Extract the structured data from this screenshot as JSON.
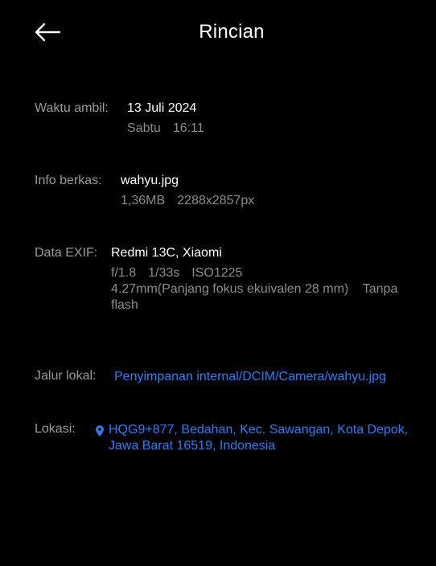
{
  "header": {
    "title": "Rincian",
    "back_icon": "arrow-left-icon"
  },
  "waktu_ambil": {
    "label": "Waktu ambil:",
    "date": "13 Juli 2024",
    "day": "Sabtu",
    "time": "16:11"
  },
  "info_berkas": {
    "label": "Info berkas:",
    "filename": "wahyu.jpg",
    "size": "1,36MB",
    "resolution": "2288x2857px"
  },
  "data_exif": {
    "label": "Data EXIF:",
    "device": "Redmi 13C, Xiaomi",
    "aperture": "f/1.8",
    "shutter": "1/33s",
    "iso": "ISO1225",
    "focal_line1": "4.27mm(Panjang fokus ekuivalen 28 mm)    Tanpa",
    "focal_line2": "flash"
  },
  "jalur_lokal": {
    "label": "Jalur lokal:",
    "path": "Penyimpanan internal/DCIM/Camera/wahyu.jpg"
  },
  "lokasi": {
    "label": "Lokasi:",
    "icon": "location-pin-icon",
    "line1": "HQG9+877, Bedahan, Kec. Sawangan, Kota Depok,",
    "line2": "Jawa Barat 16519, Indonesia"
  },
  "colors": {
    "background": "#000000",
    "label": "#9a9a9a",
    "value": "#ffffff",
    "secondary": "#8c8c8c",
    "link": "#2f7df6"
  }
}
